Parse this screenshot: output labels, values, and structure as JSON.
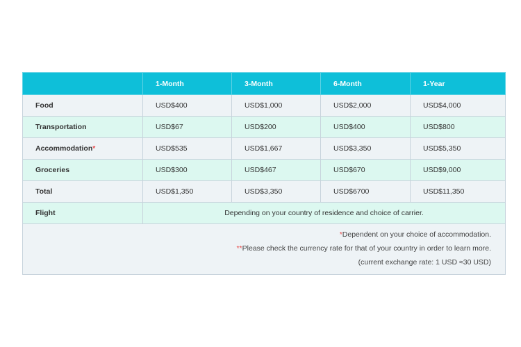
{
  "table": {
    "headers": [
      "",
      "1-Month",
      "3-Month",
      "6-Month",
      "1-Year"
    ],
    "rows": [
      {
        "label": "Food",
        "values": [
          "USD$400",
          "USD$1,000",
          "USD$2,000",
          "USD$4,000"
        ]
      },
      {
        "label": "Transportation",
        "values": [
          "USD$67",
          "USD$200",
          "USD$400",
          "USD$800"
        ]
      },
      {
        "label": "Accommodation",
        "label_mark": "*",
        "values": [
          "USD$535",
          "USD$1,667",
          "USD$3,350",
          "USD$5,350"
        ]
      },
      {
        "label": "Groceries",
        "values": [
          "USD$300",
          "USD$467",
          "USD$670",
          "USD$9,000"
        ]
      },
      {
        "label": "Total",
        "values": [
          "USD$1,350",
          "USD$3,350",
          "USD$6700",
          "USD$11,350"
        ]
      }
    ],
    "flight": {
      "label": "Flight",
      "note": "Depending on your country of residence and choice of carrier."
    }
  },
  "footnotes": {
    "note1_mark": "*",
    "note1_text": "Dependent on your choice of accommodation.",
    "note2_mark": "**",
    "note2_text": "Please check the currency rate for that of your country in order to learn more.",
    "note3_text": "(current exchange rate: 1 USD ≈30 USD)"
  },
  "colors": {
    "header_bg": "#0ebfd9",
    "row_grey": "#eef3f6",
    "row_mint": "#dcf8f0",
    "asterisk": "#e84a4a"
  }
}
